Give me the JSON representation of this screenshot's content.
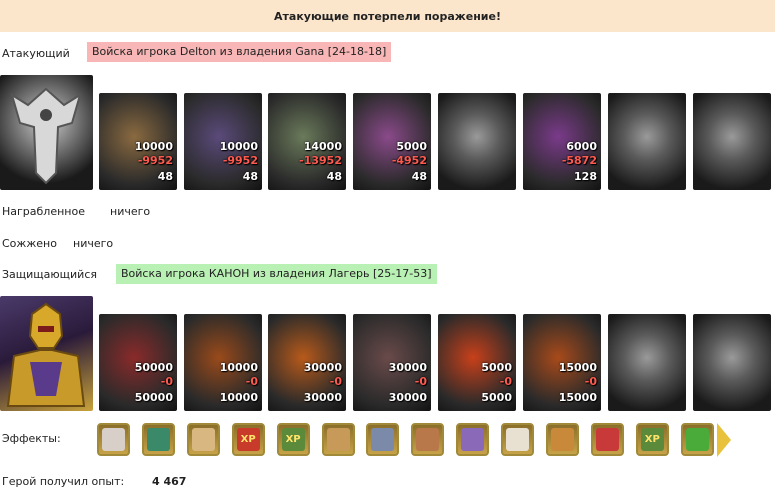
{
  "result_banner": "Атакующие потерпели поражение!",
  "attacker": {
    "label": "Атакующий",
    "army_tag": "Войска игрока Delton из владения Gana [24-18-18]",
    "hero_icon": "gray-dragon-crest-icon",
    "units": [
      {
        "count": "10000",
        "losses": "-9952",
        "survived": "48",
        "icon": "ogre-unit-icon",
        "color": "#8a6a40"
      },
      {
        "count": "10000",
        "losses": "-9952",
        "survived": "48",
        "icon": "swordsman-unit-icon",
        "color": "#5a4a7a"
      },
      {
        "count": "14000",
        "losses": "-13952",
        "survived": "48",
        "icon": "lizard-warrior-unit-icon",
        "color": "#6a7a5a"
      },
      {
        "count": "5000",
        "losses": "-4952",
        "survived": "48",
        "icon": "harpy-unit-icon",
        "color": "#8a4a8a"
      },
      {
        "count": "",
        "losses": "",
        "survived": "",
        "icon": "archer-unit-icon",
        "color": "#555555"
      },
      {
        "count": "6000",
        "losses": "-5872",
        "survived": "128",
        "icon": "sorceress-unit-icon",
        "color": "#7a3a8a"
      },
      {
        "count": "",
        "losses": "",
        "survived": "",
        "icon": "assassin-unit-icon",
        "color": "#4a4a4a"
      },
      {
        "count": "",
        "losses": "",
        "survived": "",
        "icon": "spider-rider-unit-icon",
        "color": "#4a4a4a"
      }
    ]
  },
  "loot": {
    "label": "Награбленное",
    "value": "ничего"
  },
  "burned": {
    "label": "Сожжено",
    "value": "ничего"
  },
  "defender": {
    "label": "Защищающийся",
    "army_tag": "Войска игрока КАНОН из владения Лагерь [25-17-53]",
    "hero_icon": "golden-armored-hero-icon",
    "units": [
      {
        "count": "50000",
        "losses": "-0",
        "survived": "50000",
        "icon": "red-dragon-unit-icon",
        "color": "#8a2a2a"
      },
      {
        "count": "10000",
        "losses": "-0",
        "survived": "10000",
        "icon": "flame-skeleton-unit-icon",
        "color": "#9a4a1a"
      },
      {
        "count": "30000",
        "losses": "-0",
        "survived": "30000",
        "icon": "fire-beast-unit-icon",
        "color": "#b85a1a"
      },
      {
        "count": "30000",
        "losses": "-0",
        "survived": "30000",
        "icon": "gargoyle-unit-icon",
        "color": "#6a4a4a"
      },
      {
        "count": "5000",
        "losses": "-0",
        "survived": "5000",
        "icon": "fire-elemental-unit-icon",
        "color": "#c8401a"
      },
      {
        "count": "15000",
        "losses": "-0",
        "survived": "15000",
        "icon": "fire-demon-unit-icon",
        "color": "#a84a1a"
      },
      {
        "count": "",
        "losses": "",
        "survived": "",
        "icon": "dark-knight-unit-icon",
        "color": "#4a4a4a"
      },
      {
        "count": "",
        "losses": "",
        "survived": "",
        "icon": "reaper-unit-icon",
        "color": "#3a3a3a"
      }
    ]
  },
  "effects": {
    "label": "Эффекты:",
    "items": [
      {
        "icon": "dice-icon",
        "color": "#d8d0c8"
      },
      {
        "icon": "shield-icon",
        "color": "#3a8a6a"
      },
      {
        "icon": "scroll-icon",
        "color": "#d8b880"
      },
      {
        "icon": "xp-icon",
        "color": "#c83a2a",
        "text": "XP"
      },
      {
        "icon": "xp-boost-icon",
        "color": "#5a8a3a",
        "text": "XP"
      },
      {
        "icon": "helmet-icon",
        "color": "#c89a5a"
      },
      {
        "icon": "amulet-icon",
        "color": "#7a8aa8"
      },
      {
        "icon": "armor-icon",
        "color": "#b8784a"
      },
      {
        "icon": "ring-icon",
        "color": "#8a6ab8"
      },
      {
        "icon": "map-icon",
        "color": "#e8e0d0"
      },
      {
        "icon": "torch-icon",
        "color": "#c88a3a"
      },
      {
        "icon": "horned-shield-icon",
        "color": "#c83a3a"
      },
      {
        "icon": "xp-boost-2-icon",
        "color": "#5a8a3a",
        "text": "XP"
      },
      {
        "icon": "tower-icon",
        "color": "#4aaa3a"
      }
    ],
    "next_icon": "arrow-right-icon"
  },
  "experience": {
    "label": "Герой получил опыт:",
    "value": "4 467"
  }
}
